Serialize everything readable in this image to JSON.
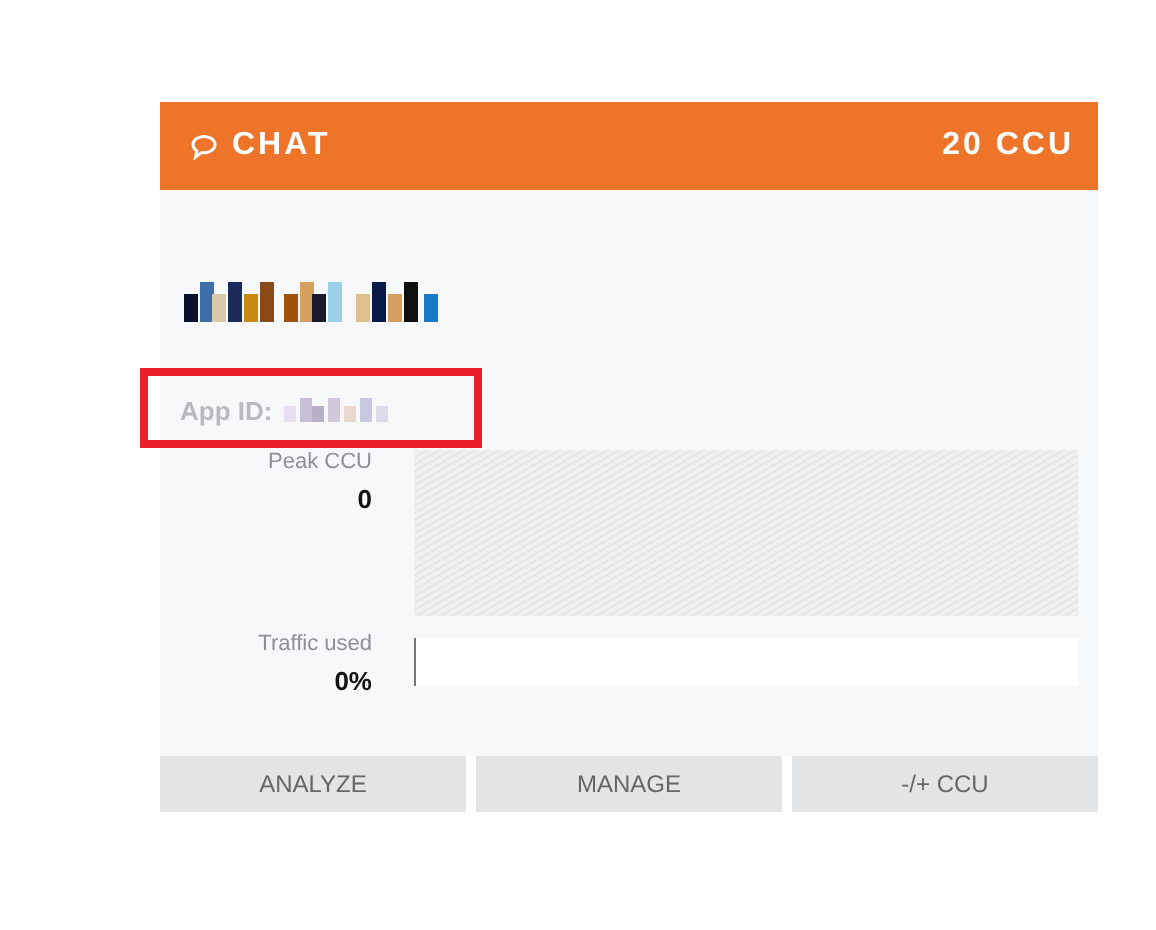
{
  "header": {
    "title": "CHAT",
    "ccu": "20 CCU"
  },
  "app_id": {
    "label": "App ID:"
  },
  "stats": [
    {
      "label": "Peak CCU",
      "value": "0",
      "kind": "chart"
    },
    {
      "label": "Traffic used",
      "value": "0%",
      "kind": "bar",
      "level": 0
    }
  ],
  "buttons": [
    "ANALYZE",
    "MANAGE",
    "-/+ CCU"
  ]
}
